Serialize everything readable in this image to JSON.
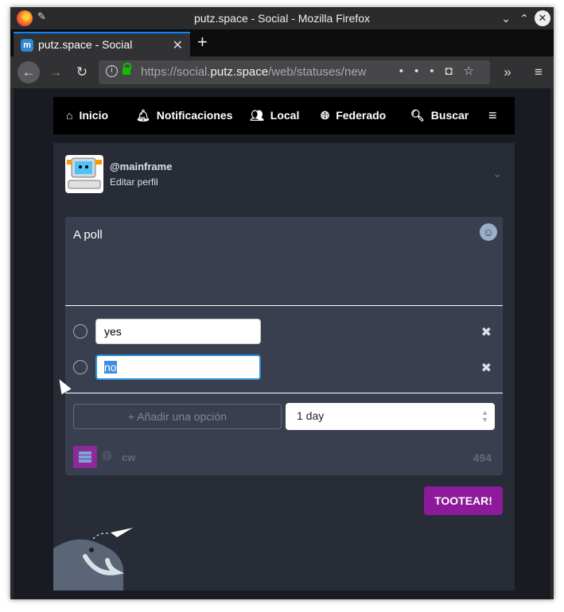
{
  "window": {
    "title": "putz.space - Social - Mozilla Firefox"
  },
  "tab": {
    "label": "putz.space - Social",
    "favicon_letter": "m"
  },
  "url": {
    "pre": "https://social.",
    "host": "putz.space",
    "path": "/web/statuses/new"
  },
  "nav": {
    "items": [
      {
        "label": "Inicio",
        "icon": "home-icon"
      },
      {
        "label": "Notificaciones",
        "icon": "bell-icon"
      },
      {
        "label": "Local",
        "icon": "users-icon"
      },
      {
        "label": "Federado",
        "icon": "globe-icon"
      },
      {
        "label": "Buscar",
        "icon": "search-icon"
      }
    ]
  },
  "account": {
    "username": "@mainframe",
    "edit_label": "Editar perfil"
  },
  "composer": {
    "text": "A poll"
  },
  "poll": {
    "options": [
      {
        "value": "yes"
      },
      {
        "value": "no"
      }
    ],
    "add_label": "Añadir una opción",
    "duration": "1 day"
  },
  "tools": {
    "cw_label": "cw",
    "char_count": "494"
  },
  "publish_label": "TOOTEAR!",
  "colors": {
    "accent": "#8c1a9a",
    "focus": "#2b90d9",
    "panel": "#282c37"
  }
}
